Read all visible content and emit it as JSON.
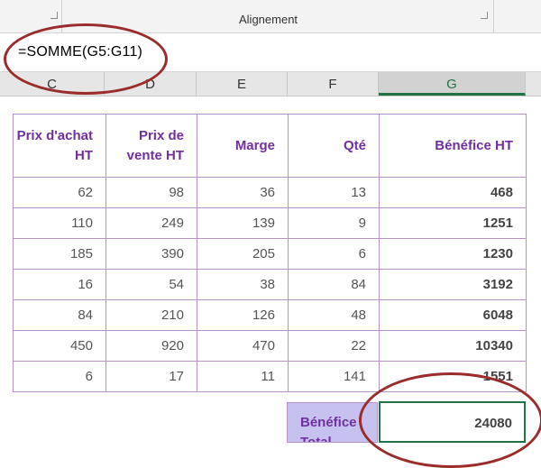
{
  "ribbon": {
    "group_label": "Alignement"
  },
  "formula_bar": {
    "formula": "=SOMME(G5:G11)"
  },
  "columns": [
    "C",
    "D",
    "E",
    "F",
    "G"
  ],
  "table": {
    "headers": [
      "Prix d'achat HT",
      "Prix de vente HT",
      "Marge",
      "Qté",
      "Bénéfice HT"
    ],
    "rows": [
      [
        "62",
        "98",
        "36",
        "13",
        "468"
      ],
      [
        "110",
        "249",
        "139",
        "9",
        "1251"
      ],
      [
        "185",
        "390",
        "205",
        "6",
        "1230"
      ],
      [
        "16",
        "54",
        "38",
        "84",
        "3192"
      ],
      [
        "84",
        "210",
        "126",
        "48",
        "6048"
      ],
      [
        "450",
        "920",
        "470",
        "22",
        "10340"
      ],
      [
        "6",
        "17",
        "11",
        "141",
        "1551"
      ]
    ]
  },
  "total": {
    "label": "Bénéfice Total",
    "value": "24080"
  },
  "colors": {
    "header_text": "#7030a0",
    "table_border": "#b693c9",
    "label_fill": "#c7c1ef",
    "selection": "#217346",
    "annotation_ring": "#9b2c2c"
  }
}
